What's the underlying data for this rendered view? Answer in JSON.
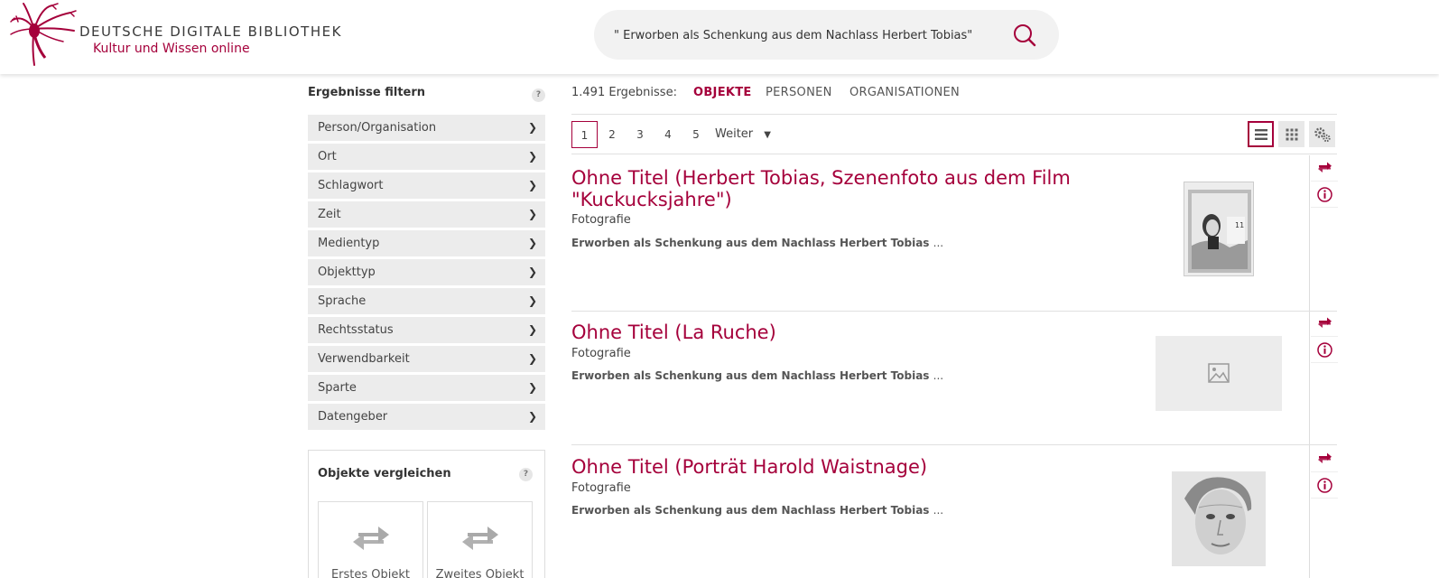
{
  "header": {
    "logo_title": "DEUTSCHE DIGITALE BIBLIOTHEK",
    "logo_subtitle": "Kultur und Wissen online",
    "search_value": "\" Erworben als Schenkung aus dem Nachlass Herbert Tobias\"",
    "search_icon": "search-icon"
  },
  "sidebar": {
    "filter_title": "Ergebnisse filtern",
    "help": "?",
    "facets": [
      "Person/Organisation",
      "Ort",
      "Schlagwort",
      "Zeit",
      "Medientyp",
      "Objekttyp",
      "Sprache",
      "Rechtsstatus",
      "Verwendbarkeit",
      "Sparte",
      "Datengeber"
    ],
    "compare": {
      "title": "Objekte vergleichen",
      "first": "Erstes Objekt",
      "second": "Zweites Objekt"
    }
  },
  "results": {
    "count": "1.491 Ergebnisse:",
    "tabs": [
      "OBJEKTE",
      "PERSONEN",
      "ORGANISATIONEN"
    ],
    "active_tab": "OBJEKTE",
    "pages": [
      "1",
      "2",
      "3",
      "4",
      "5"
    ],
    "current_page": "1",
    "next_label": "Weiter",
    "items": [
      {
        "title": "Ohne Titel (Herbert Tobias, Szenenfoto aus dem Film \"Kuckucksjahre\")",
        "type": "Fotografie",
        "desc": "Erworben als Schenkung aus dem Nachlass Herbert Tobias",
        "ellipsis": "..."
      },
      {
        "title": "Ohne Titel (La Ruche)",
        "type": "Fotografie",
        "desc": "Erworben als Schenkung aus dem Nachlass Herbert Tobias",
        "ellipsis": "..."
      },
      {
        "title": "Ohne Titel (Porträt Harold Waistnage)",
        "type": "Fotografie",
        "desc": "Erworben als Schenkung aus dem Nachlass Herbert Tobias",
        "ellipsis": "..."
      }
    ]
  },
  "colors": {
    "brand": "#a5003b",
    "facet_bg": "#ececec",
    "placeholder_bg": "#ececec"
  }
}
